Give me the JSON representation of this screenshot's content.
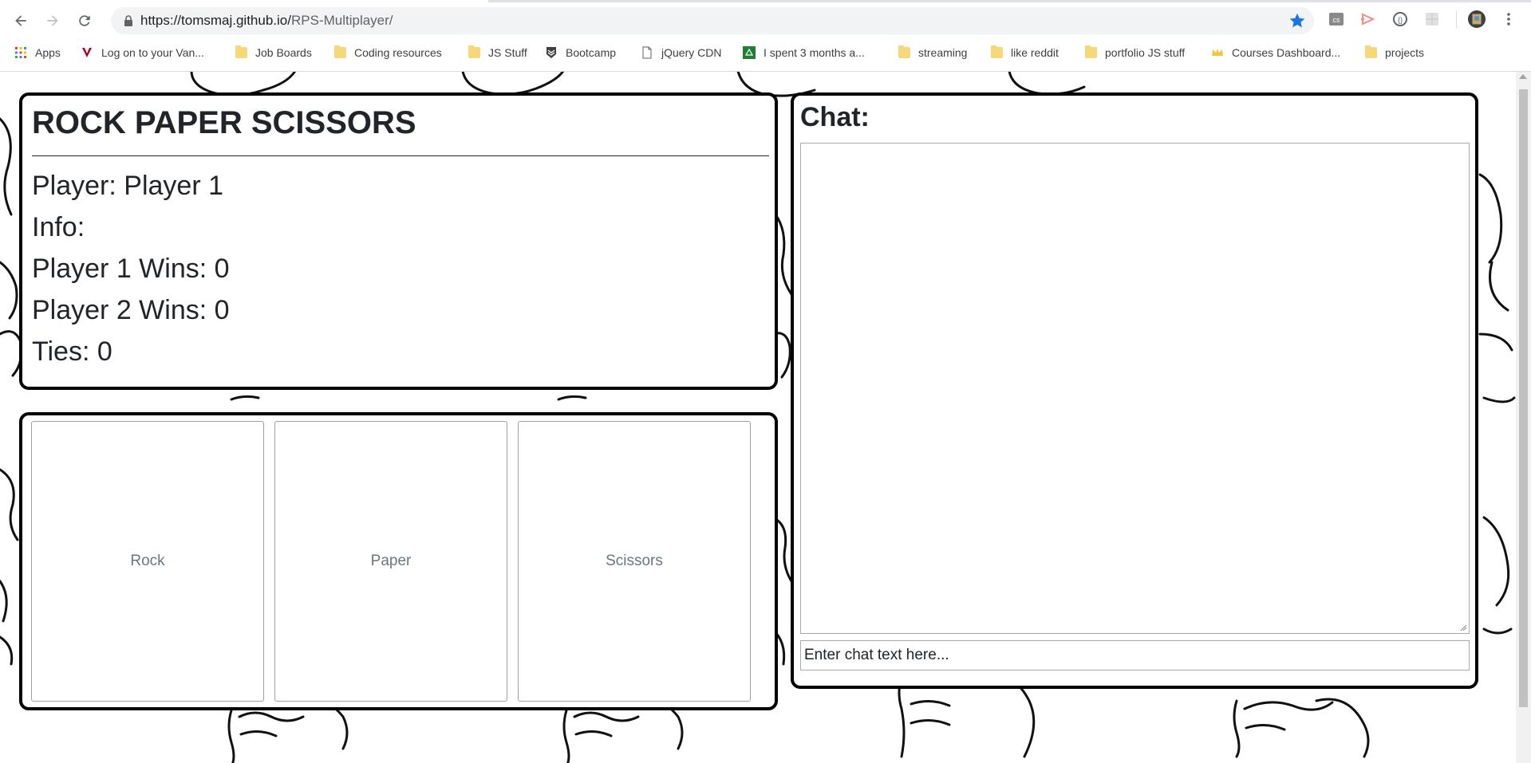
{
  "browser": {
    "url_host": "https://tomsmaj.github.io/",
    "url_path": "RPS-Multiplayer/",
    "bookmarks": [
      {
        "label": "Apps",
        "icon": "apps-grid-icon"
      },
      {
        "label": "Log on to your Van...",
        "icon": "v-logo-icon"
      },
      {
        "label": "Job Boards",
        "icon": "folder-icon"
      },
      {
        "label": "Coding resources",
        "icon": "folder-icon"
      },
      {
        "label": "JS Stuff",
        "icon": "folder-icon"
      },
      {
        "label": "Bootcamp",
        "icon": "shield-chevron-icon"
      },
      {
        "label": "jQuery CDN",
        "icon": "page-icon"
      },
      {
        "label": "I spent 3 months a...",
        "icon": "green-square-icon"
      },
      {
        "label": "streaming",
        "icon": "folder-icon"
      },
      {
        "label": "like reddit",
        "icon": "folder-icon"
      },
      {
        "label": "portfolio JS stuff",
        "icon": "folder-icon"
      },
      {
        "label": "Courses Dashboard...",
        "icon": "crown-icon"
      },
      {
        "label": "projects",
        "icon": "folder-icon"
      }
    ],
    "accent_color": "#1a73e8"
  },
  "game": {
    "title": "ROCK PAPER SCISSORS",
    "player_line": "Player: Player 1",
    "info_line": "Info:",
    "p1_wins": "Player 1 Wins: 0",
    "p2_wins": "Player 2 Wins: 0",
    "ties": "Ties: 0"
  },
  "choices": {
    "rock": "Rock",
    "paper": "Paper",
    "scissors": "Scissors"
  },
  "chat": {
    "title": "Chat:",
    "log_text": "",
    "input_placeholder": "Enter chat text here..."
  }
}
